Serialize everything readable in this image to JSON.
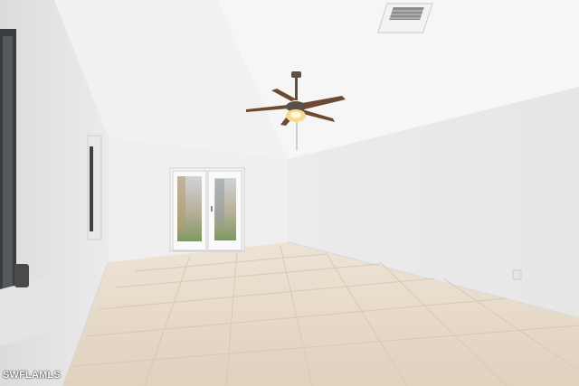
{
  "scene": {
    "objects": [
      {
        "name": "ceiling-fan",
        "icon": "ceiling-fan-icon"
      },
      {
        "name": "air-vent",
        "icon": "vent-icon"
      },
      {
        "name": "french-doors",
        "icon": "door-icon"
      },
      {
        "name": "side-windows",
        "icon": "window-icon"
      },
      {
        "name": "tile-floor",
        "icon": "tile-icon"
      }
    ]
  },
  "colors": {
    "wall": "#eeeeee",
    "ceiling": "#f7f7f7",
    "floor": "#e6d8c6",
    "grout": "#d6c6b2",
    "fan_blade": "#6e4a33",
    "fan_metal": "#5a5048",
    "window_frame": "#3a3d40",
    "exterior_green": "#6f8f55"
  },
  "watermark": {
    "text": "SWFLAMLS"
  }
}
